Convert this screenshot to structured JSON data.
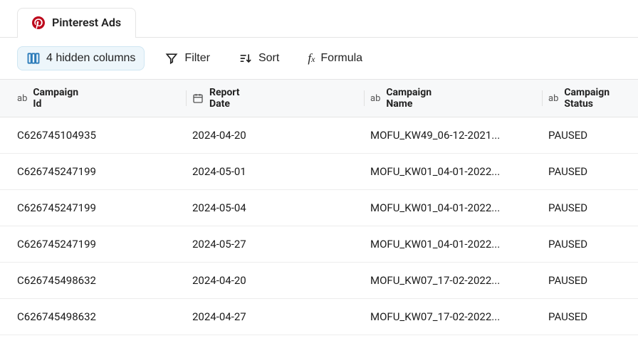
{
  "tab": {
    "label": "Pinterest Ads"
  },
  "toolbar": {
    "hidden_columns_label": "4 hidden columns",
    "filter_label": "Filter",
    "sort_label": "Sort",
    "formula_label": "Formula"
  },
  "columns": [
    {
      "type": "text",
      "label": "Campaign\nId"
    },
    {
      "type": "date",
      "label": "Report\nDate"
    },
    {
      "type": "text",
      "label": "Campaign\nName"
    },
    {
      "type": "text",
      "label": "Campaign\nStatus"
    }
  ],
  "rows": [
    {
      "campaign_id": "C626745104935",
      "report_date": "2024-04-20",
      "campaign_name": "MOFU_KW49_06-12-2021...",
      "campaign_status": "PAUSED"
    },
    {
      "campaign_id": "C626745247199",
      "report_date": "2024-05-01",
      "campaign_name": "MOFU_KW01_04-01-2022...",
      "campaign_status": "PAUSED"
    },
    {
      "campaign_id": "C626745247199",
      "report_date": "2024-05-04",
      "campaign_name": "MOFU_KW01_04-01-2022...",
      "campaign_status": "PAUSED"
    },
    {
      "campaign_id": "C626745247199",
      "report_date": "2024-05-27",
      "campaign_name": "MOFU_KW01_04-01-2022...",
      "campaign_status": "PAUSED"
    },
    {
      "campaign_id": "C626745498632",
      "report_date": "2024-04-20",
      "campaign_name": "MOFU_KW07_17-02-2022...",
      "campaign_status": "PAUSED"
    },
    {
      "campaign_id": "C626745498632",
      "report_date": "2024-04-27",
      "campaign_name": "MOFU_KW07_17-02-2022...",
      "campaign_status": "PAUSED"
    }
  ]
}
